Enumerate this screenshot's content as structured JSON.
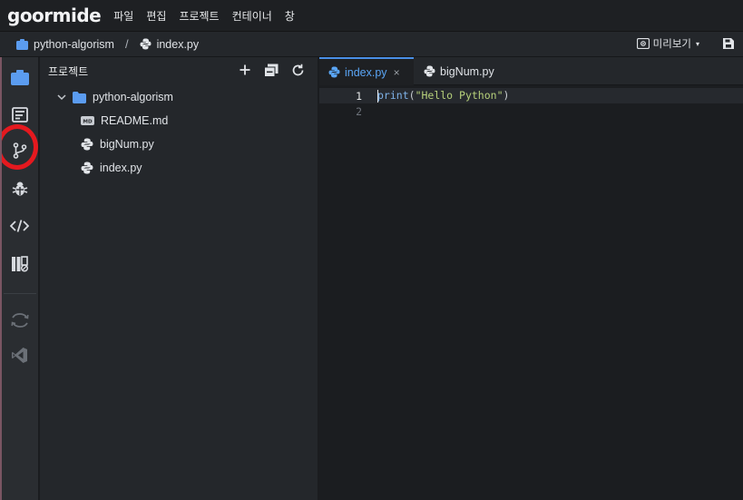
{
  "app": {
    "logo": "goormide",
    "menu": [
      "파일",
      "편집",
      "프로젝트",
      "컨테이너",
      "창"
    ]
  },
  "breadcrumb": {
    "project": "python-algorism",
    "separator": "/",
    "file": "index.py",
    "preview_label": "미리보기",
    "preview_caret": "▾"
  },
  "activity_bar": {
    "items": [
      "project-icon",
      "document-icon",
      "git-branch-icon",
      "debug-bug-icon",
      "code-tags-icon",
      "library-icon",
      "sync-icon",
      "vscode-icon"
    ],
    "highlight": {
      "item": "git-branch-icon",
      "color": "#e5191f"
    }
  },
  "explorer": {
    "title": "프로젝트",
    "actions": [
      "add-icon",
      "collapse-icon",
      "refresh-icon"
    ],
    "tree": {
      "folder": "python-algorism",
      "files": [
        {
          "name": "README.md",
          "type": "md",
          "badge": "MD"
        },
        {
          "name": "bigNum.py",
          "type": "py"
        },
        {
          "name": "index.py",
          "type": "py"
        }
      ]
    }
  },
  "editor": {
    "tabs": [
      {
        "label": "index.py",
        "active": true,
        "close": "×"
      },
      {
        "label": "bigNum.py",
        "active": false
      }
    ],
    "lines": [
      {
        "num": "1",
        "fn": "print",
        "open": "(",
        "str": "\"Hello Python\"",
        "close": ")"
      },
      {
        "num": "2",
        "fn": "",
        "open": "",
        "str": "",
        "close": ""
      }
    ]
  },
  "colors": {
    "accent": "#4a8fe7",
    "folder": "#5b9cf0",
    "string": "#b7d17b",
    "function": "#7fb2e8"
  }
}
